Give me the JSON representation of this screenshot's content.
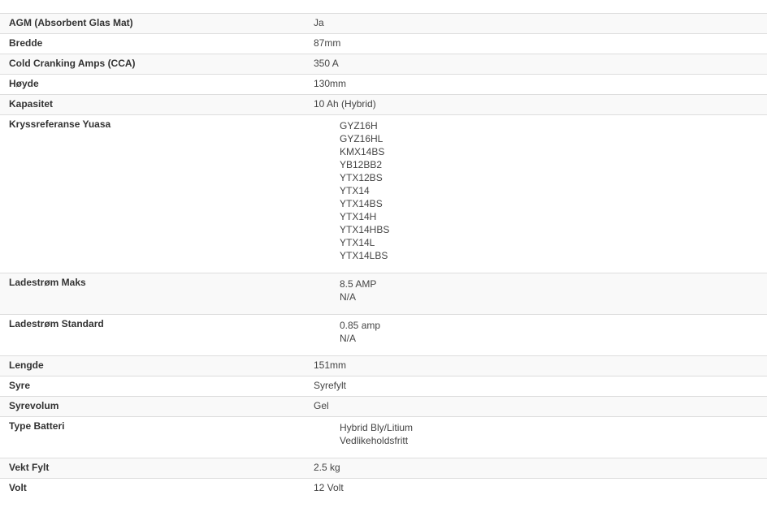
{
  "specs": [
    {
      "label": "AGM (Absorbent Glas Mat)",
      "value": "Ja"
    },
    {
      "label": "Bredde",
      "value": "87mm"
    },
    {
      "label": "Cold Cranking Amps (CCA)",
      "value": "350 A"
    },
    {
      "label": "Høyde",
      "value": "130mm"
    },
    {
      "label": "Kapasitet",
      "value": "10 Ah (Hybrid)"
    },
    {
      "label": "Kryssreferanse Yuasa",
      "values": [
        "GYZ16H",
        "GYZ16HL",
        "KMX14BS",
        "YB12BB2",
        "YTX12BS",
        "YTX14",
        "YTX14BS",
        "YTX14H",
        "YTX14HBS",
        "YTX14L",
        "YTX14LBS"
      ]
    },
    {
      "label": "Ladestrøm Maks",
      "values": [
        "8.5 AMP",
        "N/A"
      ]
    },
    {
      "label": "Ladestrøm Standard",
      "values": [
        "0.85 amp",
        "N/A"
      ]
    },
    {
      "label": "Lengde",
      "value": "151mm"
    },
    {
      "label": "Syre",
      "value": "Syrefylt"
    },
    {
      "label": "Syrevolum",
      "value": "Gel"
    },
    {
      "label": "Type Batteri",
      "values": [
        "Hybrid Bly/Litium",
        "Vedlikeholdsfritt"
      ]
    },
    {
      "label": "Vekt Fylt",
      "value": "2.5 kg"
    },
    {
      "label": "Volt",
      "value": "12 Volt"
    }
  ]
}
